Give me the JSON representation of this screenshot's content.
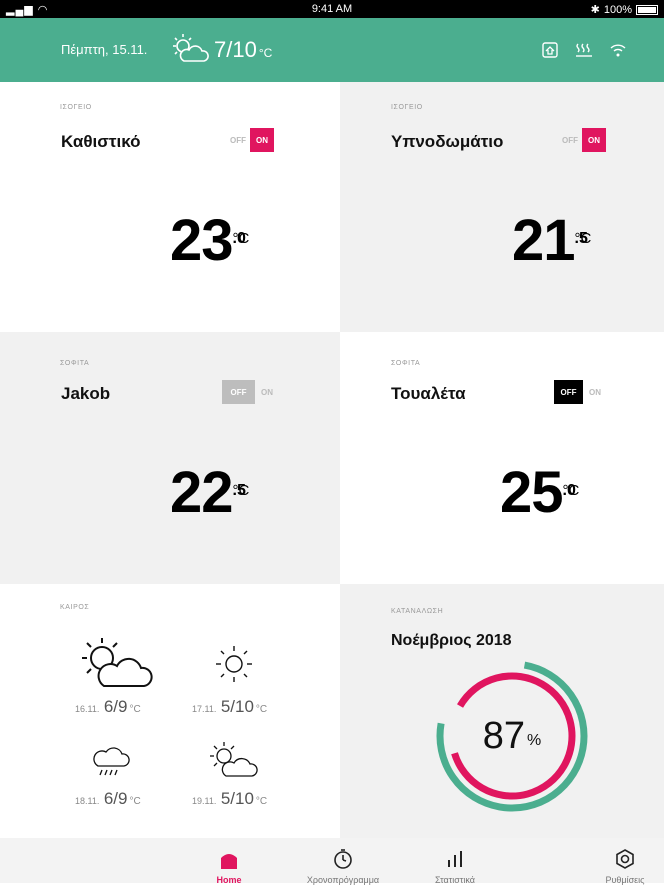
{
  "status_bar": {
    "time": "9:41 AM",
    "battery": "100%"
  },
  "header": {
    "date": "Πέμπτη, 15.11.",
    "temp": "7/10",
    "unit": "°C"
  },
  "rooms": [
    {
      "floor": "ΙΣΟΓΕΙΟ",
      "name": "Καθιστικό",
      "off": "OFF",
      "on": "ON",
      "state": "on",
      "temp_int": "23",
      "temp_dec": ".0",
      "unit": "°C"
    },
    {
      "floor": "ΙΣΟΓΕΙΟ",
      "name": "Υπνοδωμάτιο",
      "off": "OFF",
      "on": "ON",
      "state": "on",
      "temp_int": "21",
      "temp_dec": ".5",
      "unit": "°C"
    },
    {
      "floor": "ΣΟΦΙΤΑ",
      "name": "Jakob",
      "off": "OFF",
      "on": "ON",
      "state": "off-disabled",
      "temp_int": "22",
      "temp_dec": ".5",
      "unit": "°C"
    },
    {
      "floor": "ΣΟΦΙΤΑ",
      "name": "Τουαλέτα",
      "off": "OFF",
      "on": "ON",
      "state": "off",
      "temp_int": "25",
      "temp_dec": ".0",
      "unit": "°C"
    }
  ],
  "weather": {
    "caption": "ΚΑΙΡΟΣ",
    "forecast": [
      {
        "date": "16.11.",
        "temp": "6/9",
        "unit": "°C",
        "icon": "partly-cloudy-icon"
      },
      {
        "date": "17.11.",
        "temp": "5/10",
        "unit": "°C",
        "icon": "sun-icon"
      },
      {
        "date": "18.11.",
        "temp": "6/9",
        "unit": "°C",
        "icon": "rain-cloud-icon"
      },
      {
        "date": "19.11.",
        "temp": "5/10",
        "unit": "°C",
        "icon": "partly-cloudy-icon"
      }
    ]
  },
  "consumption": {
    "caption": "ΚΑΤΑΝΑΛΩΣΗ",
    "month": "Νοέμβριος 2018",
    "percent": 87,
    "percent_text": "87",
    "percent_unit": "%",
    "outer_ring_fraction": 0.75,
    "inner_ring_fraction": 0.87
  },
  "tabbar": {
    "items": [
      {
        "label": "Home",
        "icon": "home-icon",
        "active": true
      },
      {
        "label": "Χρονοπρόγραμμα",
        "icon": "timer-icon",
        "active": false
      },
      {
        "label": "Στατιστικά",
        "icon": "stats-icon",
        "active": false
      },
      {
        "label": "Ρυθμίσεις",
        "icon": "settings-icon",
        "active": false
      }
    ]
  },
  "colors": {
    "accent": "#e0155f",
    "green": "#4bae8f",
    "header": "#4bae8f"
  }
}
